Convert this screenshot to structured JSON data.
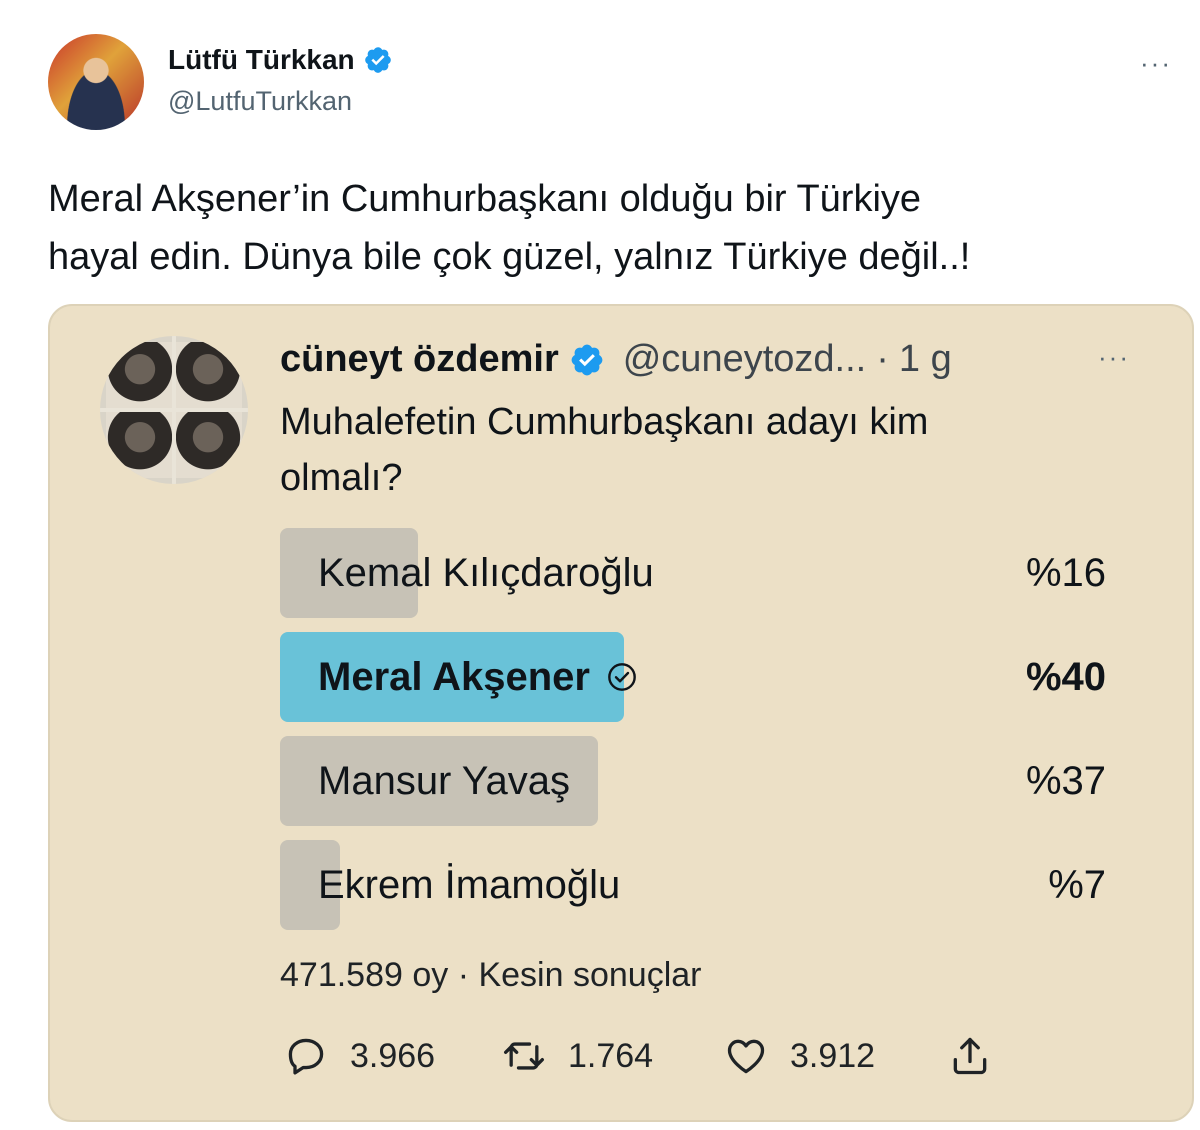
{
  "author": {
    "name": "Lütfü Türkkan",
    "handle": "@LutfuTurkkan"
  },
  "menu": {
    "more_label": "···"
  },
  "tweet": {
    "text_line1": "Meral Akşener’in Cumhurbaşkanı olduğu bir Türkiye",
    "text_line2": "hayal edin. Dünya bile çok güzel, yalnız Türkiye değil..!"
  },
  "quoted": {
    "name": "cüneyt özdemir",
    "handle": "@cuneytozd...",
    "dot": "·",
    "time": "1 g",
    "more_label": "···",
    "text_line1": "Muhalefetin Cumhurbaşkanı adayı kim",
    "text_line2": "olmalı?",
    "poll": {
      "options": [
        {
          "label": "Kemal Kılıçdaroğlu",
          "pct_text": "%16",
          "percent": 16,
          "winner": false
        },
        {
          "label": "Meral Akşener",
          "pct_text": "%40",
          "percent": 40,
          "winner": true
        },
        {
          "label": "Mansur Yavaş",
          "pct_text": "%37",
          "percent": 37,
          "winner": false
        },
        {
          "label": "Ekrem İmamoğlu",
          "pct_text": "%7",
          "percent": 7,
          "winner": false
        }
      ],
      "footer": "471.589 oy · Kesin sonuçlar"
    },
    "actions": {
      "replies": "3.966",
      "retweets": "1.764",
      "likes": "3.912"
    }
  },
  "colors": {
    "card_bg": "#ece0c6",
    "winner_bar": "#69c2d8",
    "loser_bar": "#c7c2b6",
    "verified_blue": "#1d9bf0"
  },
  "icons": [
    "verified-badge-icon",
    "check-circle-icon",
    "reply-icon",
    "retweet-icon",
    "like-icon",
    "share-icon",
    "more-icon"
  ]
}
